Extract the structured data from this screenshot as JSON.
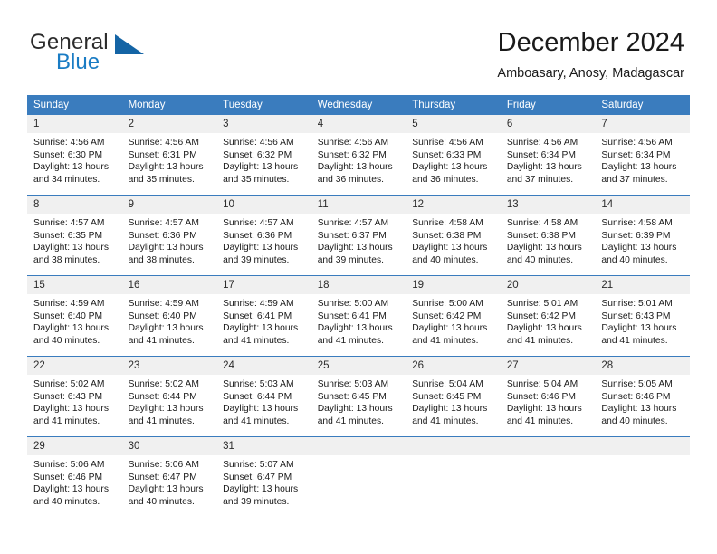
{
  "brand": {
    "name_part1": "General",
    "name_part2": "Blue",
    "accent_color": "#1464a5",
    "logo_icon": "triangle-mark"
  },
  "header": {
    "month_title": "December 2024",
    "location": "Amboasary, Anosy, Madagascar"
  },
  "theme": {
    "header_blue": "#3a7cbe",
    "daynum_gray": "#f0f0f0"
  },
  "calendar": {
    "weekday_headers": [
      "Sunday",
      "Monday",
      "Tuesday",
      "Wednesday",
      "Thursday",
      "Friday",
      "Saturday"
    ],
    "weeks": [
      [
        {
          "day": "1",
          "sunrise": "Sunrise: 4:56 AM",
          "sunset": "Sunset: 6:30 PM",
          "daylight1": "Daylight: 13 hours",
          "daylight2": "and 34 minutes."
        },
        {
          "day": "2",
          "sunrise": "Sunrise: 4:56 AM",
          "sunset": "Sunset: 6:31 PM",
          "daylight1": "Daylight: 13 hours",
          "daylight2": "and 35 minutes."
        },
        {
          "day": "3",
          "sunrise": "Sunrise: 4:56 AM",
          "sunset": "Sunset: 6:32 PM",
          "daylight1": "Daylight: 13 hours",
          "daylight2": "and 35 minutes."
        },
        {
          "day": "4",
          "sunrise": "Sunrise: 4:56 AM",
          "sunset": "Sunset: 6:32 PM",
          "daylight1": "Daylight: 13 hours",
          "daylight2": "and 36 minutes."
        },
        {
          "day": "5",
          "sunrise": "Sunrise: 4:56 AM",
          "sunset": "Sunset: 6:33 PM",
          "daylight1": "Daylight: 13 hours",
          "daylight2": "and 36 minutes."
        },
        {
          "day": "6",
          "sunrise": "Sunrise: 4:56 AM",
          "sunset": "Sunset: 6:34 PM",
          "daylight1": "Daylight: 13 hours",
          "daylight2": "and 37 minutes."
        },
        {
          "day": "7",
          "sunrise": "Sunrise: 4:56 AM",
          "sunset": "Sunset: 6:34 PM",
          "daylight1": "Daylight: 13 hours",
          "daylight2": "and 37 minutes."
        }
      ],
      [
        {
          "day": "8",
          "sunrise": "Sunrise: 4:57 AM",
          "sunset": "Sunset: 6:35 PM",
          "daylight1": "Daylight: 13 hours",
          "daylight2": "and 38 minutes."
        },
        {
          "day": "9",
          "sunrise": "Sunrise: 4:57 AM",
          "sunset": "Sunset: 6:36 PM",
          "daylight1": "Daylight: 13 hours",
          "daylight2": "and 38 minutes."
        },
        {
          "day": "10",
          "sunrise": "Sunrise: 4:57 AM",
          "sunset": "Sunset: 6:36 PM",
          "daylight1": "Daylight: 13 hours",
          "daylight2": "and 39 minutes."
        },
        {
          "day": "11",
          "sunrise": "Sunrise: 4:57 AM",
          "sunset": "Sunset: 6:37 PM",
          "daylight1": "Daylight: 13 hours",
          "daylight2": "and 39 minutes."
        },
        {
          "day": "12",
          "sunrise": "Sunrise: 4:58 AM",
          "sunset": "Sunset: 6:38 PM",
          "daylight1": "Daylight: 13 hours",
          "daylight2": "and 40 minutes."
        },
        {
          "day": "13",
          "sunrise": "Sunrise: 4:58 AM",
          "sunset": "Sunset: 6:38 PM",
          "daylight1": "Daylight: 13 hours",
          "daylight2": "and 40 minutes."
        },
        {
          "day": "14",
          "sunrise": "Sunrise: 4:58 AM",
          "sunset": "Sunset: 6:39 PM",
          "daylight1": "Daylight: 13 hours",
          "daylight2": "and 40 minutes."
        }
      ],
      [
        {
          "day": "15",
          "sunrise": "Sunrise: 4:59 AM",
          "sunset": "Sunset: 6:40 PM",
          "daylight1": "Daylight: 13 hours",
          "daylight2": "and 40 minutes."
        },
        {
          "day": "16",
          "sunrise": "Sunrise: 4:59 AM",
          "sunset": "Sunset: 6:40 PM",
          "daylight1": "Daylight: 13 hours",
          "daylight2": "and 41 minutes."
        },
        {
          "day": "17",
          "sunrise": "Sunrise: 4:59 AM",
          "sunset": "Sunset: 6:41 PM",
          "daylight1": "Daylight: 13 hours",
          "daylight2": "and 41 minutes."
        },
        {
          "day": "18",
          "sunrise": "Sunrise: 5:00 AM",
          "sunset": "Sunset: 6:41 PM",
          "daylight1": "Daylight: 13 hours",
          "daylight2": "and 41 minutes."
        },
        {
          "day": "19",
          "sunrise": "Sunrise: 5:00 AM",
          "sunset": "Sunset: 6:42 PM",
          "daylight1": "Daylight: 13 hours",
          "daylight2": "and 41 minutes."
        },
        {
          "day": "20",
          "sunrise": "Sunrise: 5:01 AM",
          "sunset": "Sunset: 6:42 PM",
          "daylight1": "Daylight: 13 hours",
          "daylight2": "and 41 minutes."
        },
        {
          "day": "21",
          "sunrise": "Sunrise: 5:01 AM",
          "sunset": "Sunset: 6:43 PM",
          "daylight1": "Daylight: 13 hours",
          "daylight2": "and 41 minutes."
        }
      ],
      [
        {
          "day": "22",
          "sunrise": "Sunrise: 5:02 AM",
          "sunset": "Sunset: 6:43 PM",
          "daylight1": "Daylight: 13 hours",
          "daylight2": "and 41 minutes."
        },
        {
          "day": "23",
          "sunrise": "Sunrise: 5:02 AM",
          "sunset": "Sunset: 6:44 PM",
          "daylight1": "Daylight: 13 hours",
          "daylight2": "and 41 minutes."
        },
        {
          "day": "24",
          "sunrise": "Sunrise: 5:03 AM",
          "sunset": "Sunset: 6:44 PM",
          "daylight1": "Daylight: 13 hours",
          "daylight2": "and 41 minutes."
        },
        {
          "day": "25",
          "sunrise": "Sunrise: 5:03 AM",
          "sunset": "Sunset: 6:45 PM",
          "daylight1": "Daylight: 13 hours",
          "daylight2": "and 41 minutes."
        },
        {
          "day": "26",
          "sunrise": "Sunrise: 5:04 AM",
          "sunset": "Sunset: 6:45 PM",
          "daylight1": "Daylight: 13 hours",
          "daylight2": "and 41 minutes."
        },
        {
          "day": "27",
          "sunrise": "Sunrise: 5:04 AM",
          "sunset": "Sunset: 6:46 PM",
          "daylight1": "Daylight: 13 hours",
          "daylight2": "and 41 minutes."
        },
        {
          "day": "28",
          "sunrise": "Sunrise: 5:05 AM",
          "sunset": "Sunset: 6:46 PM",
          "daylight1": "Daylight: 13 hours",
          "daylight2": "and 40 minutes."
        }
      ],
      [
        {
          "day": "29",
          "sunrise": "Sunrise: 5:06 AM",
          "sunset": "Sunset: 6:46 PM",
          "daylight1": "Daylight: 13 hours",
          "daylight2": "and 40 minutes."
        },
        {
          "day": "30",
          "sunrise": "Sunrise: 5:06 AM",
          "sunset": "Sunset: 6:47 PM",
          "daylight1": "Daylight: 13 hours",
          "daylight2": "and 40 minutes."
        },
        {
          "day": "31",
          "sunrise": "Sunrise: 5:07 AM",
          "sunset": "Sunset: 6:47 PM",
          "daylight1": "Daylight: 13 hours",
          "daylight2": "and 39 minutes."
        },
        {
          "day": "",
          "sunrise": "",
          "sunset": "",
          "daylight1": "",
          "daylight2": ""
        },
        {
          "day": "",
          "sunrise": "",
          "sunset": "",
          "daylight1": "",
          "daylight2": ""
        },
        {
          "day": "",
          "sunrise": "",
          "sunset": "",
          "daylight1": "",
          "daylight2": ""
        },
        {
          "day": "",
          "sunrise": "",
          "sunset": "",
          "daylight1": "",
          "daylight2": ""
        }
      ]
    ]
  }
}
